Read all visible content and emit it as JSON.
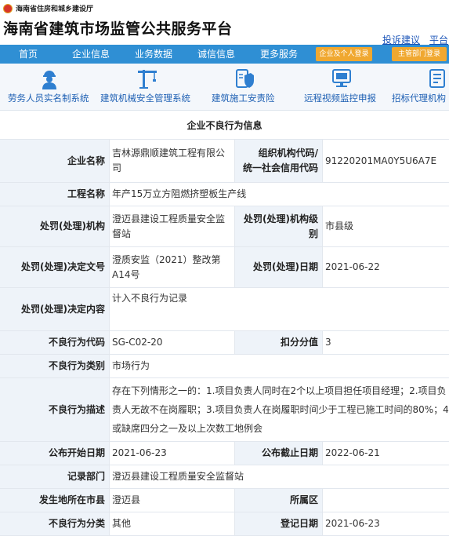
{
  "header": {
    "department": "海南省住房和城乡建设厅",
    "title": "海南省建筑市场监管公共服务平台",
    "links": [
      "投诉建议",
      "平台"
    ]
  },
  "nav": {
    "items": [
      "首页",
      "企业信息",
      "业务数据",
      "诚信信息",
      "更多服务"
    ],
    "login_enterprise": "企业及个人登录",
    "login_dept": "主管部门登录"
  },
  "icons": [
    {
      "label": "劳务人员实名制系统",
      "icon": "worker-icon"
    },
    {
      "label": "建筑机械安全管理系统",
      "icon": "crane-icon"
    },
    {
      "label": "建筑施工安责险",
      "icon": "insurance-icon"
    },
    {
      "label": "远程视频监控申报",
      "icon": "monitor-icon"
    },
    {
      "label": "招标代理机构",
      "icon": "document-icon"
    }
  ],
  "record": {
    "section_title": "企业不良行为信息",
    "company_name_label": "企业名称",
    "company_name": "吉林源鼎顺建筑工程有限公司",
    "org_code_label_1": "组织机构代码/",
    "org_code_label_2": "统一社会信用代码",
    "org_code": "91220201MA0Y5U6A7E",
    "project_label": "工程名称",
    "project": "年产15万立方阻燃挤塑板生产线",
    "agency_label": "处罚(处理)机构",
    "agency": "澄迈县建设工程质量安全监督站",
    "agency_level_label": "处罚(处理)机构级别",
    "agency_level": "市县级",
    "decision_no_label": "处罚(处理)决定文号",
    "decision_no": "澄质安监（2021）整改第A14号",
    "decision_date_label": "处罚(处理)日期",
    "decision_date": "2021-06-22",
    "decision_content_label": "处罚(处理)决定内容",
    "decision_content": "计入不良行为记录",
    "behavior_code_label": "不良行为代码",
    "behavior_code": "SG-C02-20",
    "points_label": "扣分分值",
    "points": "3",
    "category_label": "不良行为类别",
    "category": "市场行为",
    "description_label": "不良行为描述",
    "description": "存在下列情形之一的：1.项目负责人同时在2个以上项目担任项目经理；2.项目负责人无故不在岗履职；3.项目负责人在岗履职时间少于工程已施工时间的80%；4.或缺席四分之一及以上次数工地例会",
    "publish_start_label": "公布开始日期",
    "publish_start": "2021-06-23",
    "publish_end_label": "公布截止日期",
    "publish_end": "2022-06-21",
    "record_dept_label": "记录部门",
    "record_dept": "澄迈县建设工程质量安全监督站",
    "city_label": "发生地所在市县",
    "city": "澄迈县",
    "district_label": "所属区",
    "district": "",
    "classification_label": "不良行为分类",
    "classification": "其他",
    "register_date_label": "登记日期",
    "register_date": "2021-06-23"
  },
  "colors": {
    "nav": "#2f8fd4",
    "accent": "#f0a830",
    "link": "#1a54b8",
    "label_bg": "#eef3f9"
  }
}
